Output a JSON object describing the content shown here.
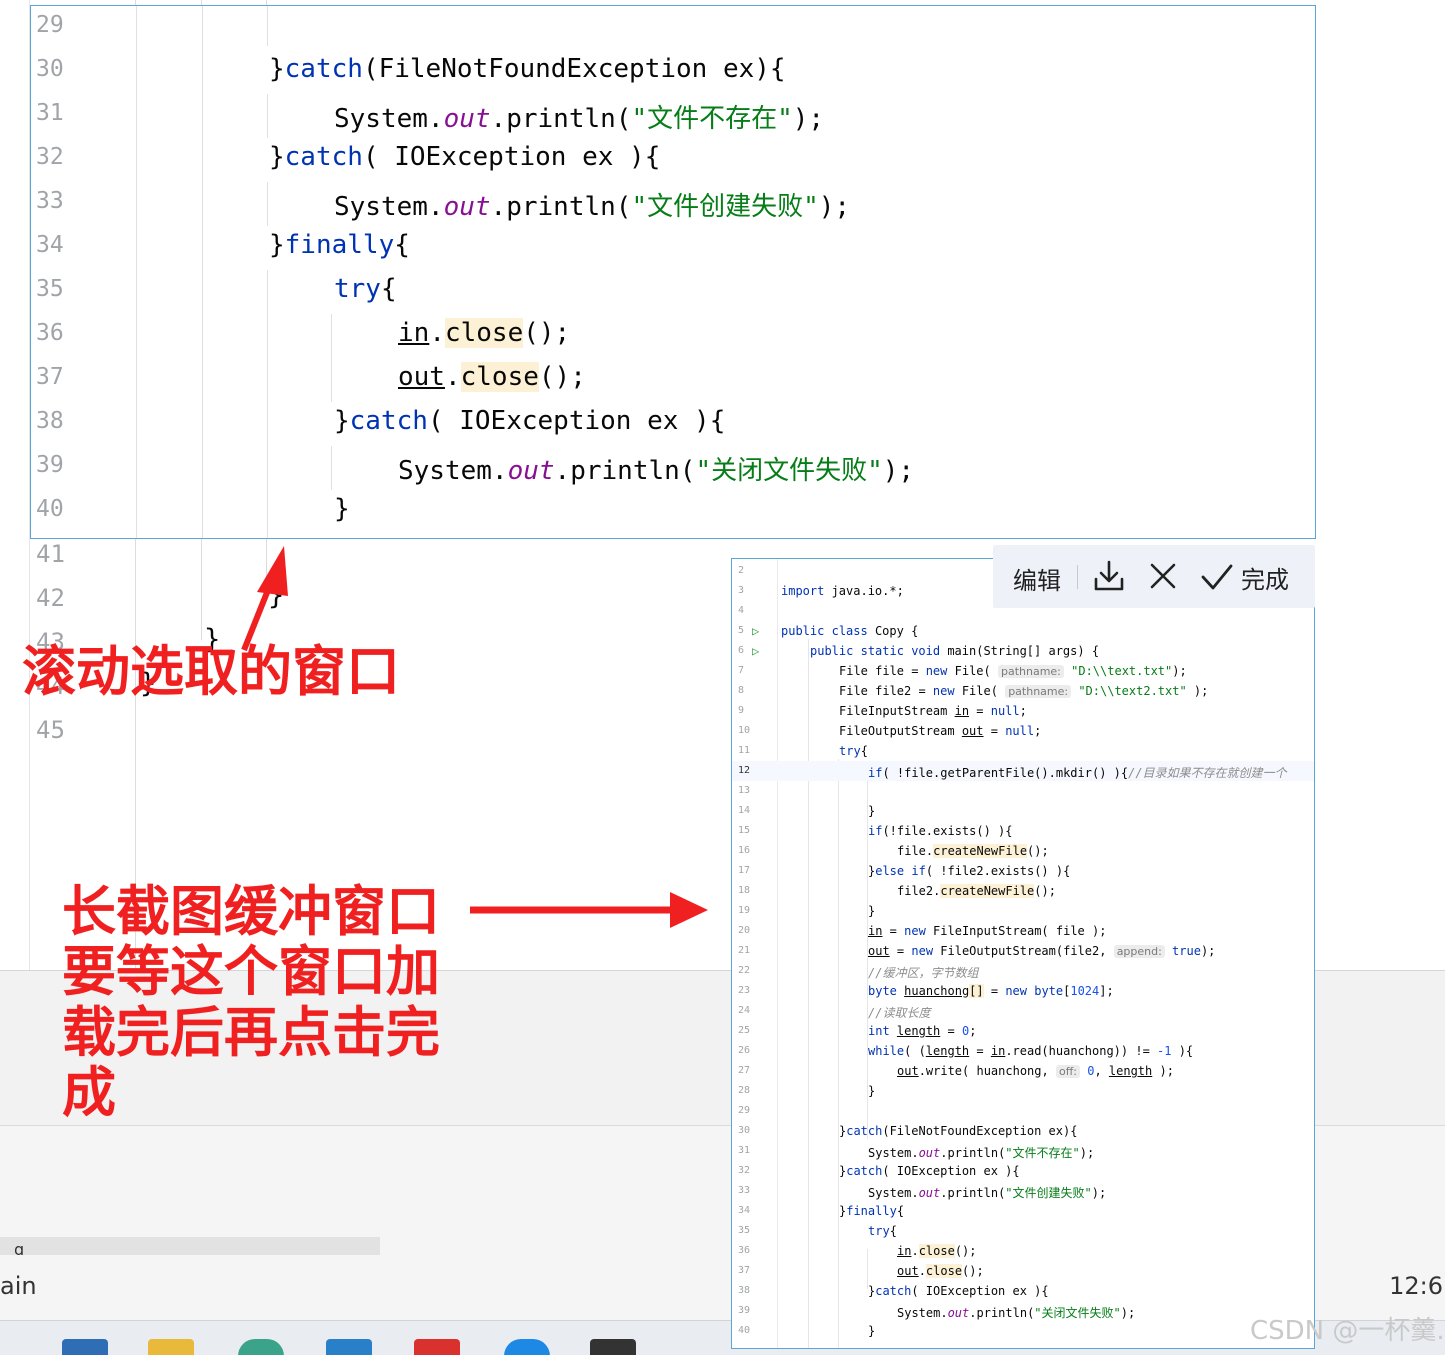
{
  "background_editor": {
    "line_numbers": [
      "41",
      "42",
      "43",
      "44",
      "45"
    ],
    "brace_42": "}",
    "brace_43": "}",
    "brace_44": "}",
    "status_left": "ain",
    "status_right": "12:6",
    "small_icon": "ɑ"
  },
  "scroll_window": {
    "lines": [
      {
        "n": "29"
      },
      {
        "n": "30"
      },
      {
        "n": "31"
      },
      {
        "n": "32"
      },
      {
        "n": "33"
      },
      {
        "n": "34"
      },
      {
        "n": "35"
      },
      {
        "n": "36"
      },
      {
        "n": "37"
      },
      {
        "n": "38"
      },
      {
        "n": "39"
      },
      {
        "n": "40"
      }
    ],
    "code": {
      "l30_a": "}",
      "l30_kw": "catch",
      "l30_b": "(FileNotFoundException ex){",
      "l31_a": "System.",
      "l31_f": "out",
      "l31_b": ".println(",
      "l31_s": "\"文件不存在\"",
      "l31_c": ");",
      "l32_a": "}",
      "l32_kw": "catch",
      "l32_b": "( IOException ex ){",
      "l33_a": "System.",
      "l33_f": "out",
      "l33_b": ".println(",
      "l33_s": "\"文件创建失败\"",
      "l33_c": ");",
      "l34_a": "}",
      "l34_kw": "finally",
      "l34_b": "{",
      "l35_kw": "try",
      "l35_b": "{",
      "l36_a": "in",
      "l36_dot": ".",
      "l36_m": "close",
      "l36_b": "();",
      "l37_a": "out",
      "l37_dot": ".",
      "l37_m": "close",
      "l37_b": "();",
      "l38_a": "}",
      "l38_kw": "catch",
      "l38_b": "( IOException ex ){",
      "l39_a": "System.",
      "l39_f": "out",
      "l39_b": ".println(",
      "l39_s": "\"关闭文件失败\"",
      "l39_c": ");",
      "l40_a": "}"
    }
  },
  "annotations": {
    "scroll_label": "滚动选取的窗口",
    "buffer_label": "长截图缓冲窗口要等这个窗口加载完后再点击完成"
  },
  "toolbar": {
    "edit_label": "编辑",
    "download_icon": "download-icon",
    "close_icon": "close-icon",
    "done_label": "完成"
  },
  "buffer_window": {
    "line_numbers": [
      "2",
      "3",
      "4",
      "5",
      "6",
      "7",
      "8",
      "9",
      "10",
      "11",
      "12",
      "13",
      "14",
      "15",
      "16",
      "17",
      "18",
      "19",
      "20",
      "21",
      "22",
      "23",
      "24",
      "25",
      "26",
      "27",
      "28",
      "29",
      "30",
      "31",
      "32",
      "33",
      "34",
      "35",
      "36",
      "37",
      "38",
      "39",
      "40"
    ],
    "b3_kw": "import",
    "b3_rest": " java.io.*;",
    "b5_kw1": "public",
    "b5_kw2": "class",
    "b5_rest": " Copy {",
    "b6_kw1": "public",
    "b6_kw2": "static",
    "b6_kw3": "void",
    "b6_m": "main",
    "b6_rest": "(String[] args) {",
    "b7_a": "File file = ",
    "b7_kw": "new",
    "b7_b": " File( ",
    "b7_hint": "pathname:",
    "b7_s": " \"D:\\\\text.txt\"",
    "b7_c": ");",
    "b8_a": "File file2 = ",
    "b8_kw": "new",
    "b8_b": " File( ",
    "b8_hint": "pathname:",
    "b8_s": " \"D:\\\\text2.txt\"",
    "b8_c": " );",
    "b9_a": "FileInputStream ",
    "b9_u": "in",
    "b9_b": " = ",
    "b9_kw": "null",
    "b9_c": ";",
    "b10_a": "FileOutputStream ",
    "b10_u": "out",
    "b10_b": " = ",
    "b10_kw": "null",
    "b10_c": ";",
    "b11_kw": "try",
    "b11_b": "{",
    "b12_kw": "if",
    "b12_b": "( !file.getParentFile().mkdir() ){",
    "b12_cmt": "//目录如果不存在就创建一个",
    "b14_a": "}",
    "b15_kw": "if",
    "b15_b": "(!file.exists() ){",
    "b16_a": "file.",
    "b16_m": "createNewFile",
    "b16_b": "();",
    "b17_a": "}",
    "b17_kw1": "else",
    "b17_kw2": "if",
    "b17_b": "( !file2.exists() ){",
    "b18_a": "file2.",
    "b18_m": "createNewFile",
    "b18_b": "();",
    "b19_a": "}",
    "b20_u": "in",
    "b20_b": " = ",
    "b20_kw": "new",
    "b20_c": " FileInputStream( file );",
    "b21_u": "out",
    "b21_b": " = ",
    "b21_kw": "new",
    "b21_c": " FileOutputStream(file2, ",
    "b21_hint": "append:",
    "b21_kw2": " true",
    "b21_d": ");",
    "b22_cmt": "//缓冲区，字节数组",
    "b23_kw": "byte",
    "b23_u": "huanchong",
    "b23_hl": "[]",
    "b23_b": " = ",
    "b23_kw2": "new",
    "b23_kw3": " byte",
    "b23_c": "[",
    "b23_n": "1024",
    "b23_d": "];",
    "b24_cmt": "//读取长度",
    "b25_kw": "int",
    "b25_u": "length",
    "b25_b": " = ",
    "b25_n": "0",
    "b25_c": ";",
    "b26_kw": "while",
    "b26_b": "( (",
    "b26_u": "length",
    "b26_c": " = ",
    "b26_u2": "in",
    "b26_d": ".read(huanchong)) != ",
    "b26_n": "-1",
    "b26_e": " ){",
    "b27_u": "out",
    "b27_b": ".write( huanchong, ",
    "b27_hint": "off:",
    "b27_n": " 0",
    "b27_c": ", ",
    "b27_u2": "length",
    "b27_d": " );",
    "b28_a": "}",
    "b30_a": "}",
    "b30_kw": "catch",
    "b30_b": "(FileNotFoundException ex){",
    "b31_a": "System.",
    "b31_f": "out",
    "b31_b": ".println(",
    "b31_s": "\"文件不存在\"",
    "b31_c": ");",
    "b32_a": "}",
    "b32_kw": "catch",
    "b32_b": "( IOException ex ){",
    "b33_a": "System.",
    "b33_f": "out",
    "b33_b": ".println(",
    "b33_s": "\"文件创建失败\"",
    "b33_c": ");",
    "b34_a": "}",
    "b34_kw": "finally",
    "b34_b": "{",
    "b35_kw": "try",
    "b35_b": "{",
    "b36_u": "in",
    "b36_dot": ".",
    "b36_m": "close",
    "b36_b": "();",
    "b37_u": "out",
    "b37_dot": ".",
    "b37_m": "close",
    "b37_b": "();",
    "b38_a": "}",
    "b38_kw": "catch",
    "b38_b": "( IOException ex ){",
    "b39_a": "System.",
    "b39_f": "out",
    "b39_b": ".println(",
    "b39_s": "\"关闭文件失败\"",
    "b39_c": ");",
    "b40_a": "}"
  },
  "watermark": "CSDN @一杯羹."
}
